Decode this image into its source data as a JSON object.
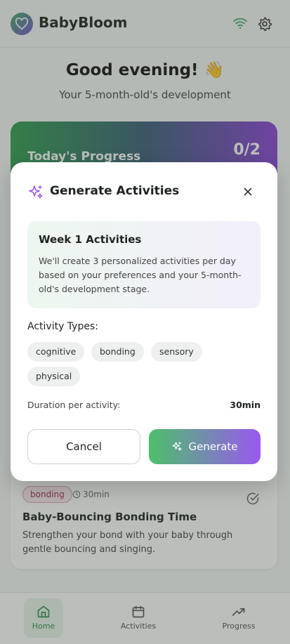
{
  "app": {
    "title": "BabyBloom",
    "greeting": "Good evening! 👋",
    "subgreeting": "Your 5-month-old's development"
  },
  "progress_card": {
    "title": "Today's Progress",
    "count": "0/2"
  },
  "activity_card": {
    "tag": "bonding",
    "duration": "30min",
    "title": "Baby-Bouncing Bonding Time",
    "description": "Strengthen your bond with your baby through gentle bouncing and singing."
  },
  "bottom_nav": {
    "items": [
      {
        "label": "Home",
        "icon": "home-icon",
        "active": true
      },
      {
        "label": "Activities",
        "icon": "calendar-icon",
        "active": false
      },
      {
        "label": "Progress",
        "icon": "trending-up-icon",
        "active": false
      }
    ]
  },
  "modal": {
    "title": "Generate Activities",
    "info_title": "Week 1 Activities",
    "info_text": "We'll create 3 personalized activities per day based on your preferences and your 5-month-old's development stage.",
    "types_label": "Activity Types:",
    "types": [
      "cognitive",
      "bonding",
      "sensory",
      "physical"
    ],
    "duration_label": "Duration per activity:",
    "duration_value": "30min",
    "cancel_label": "Cancel",
    "generate_label": "Generate"
  },
  "colors": {
    "primary_green": "#3fae5e",
    "primary_purple": "#9a58f0",
    "bonding_tag": "#a0304b"
  }
}
